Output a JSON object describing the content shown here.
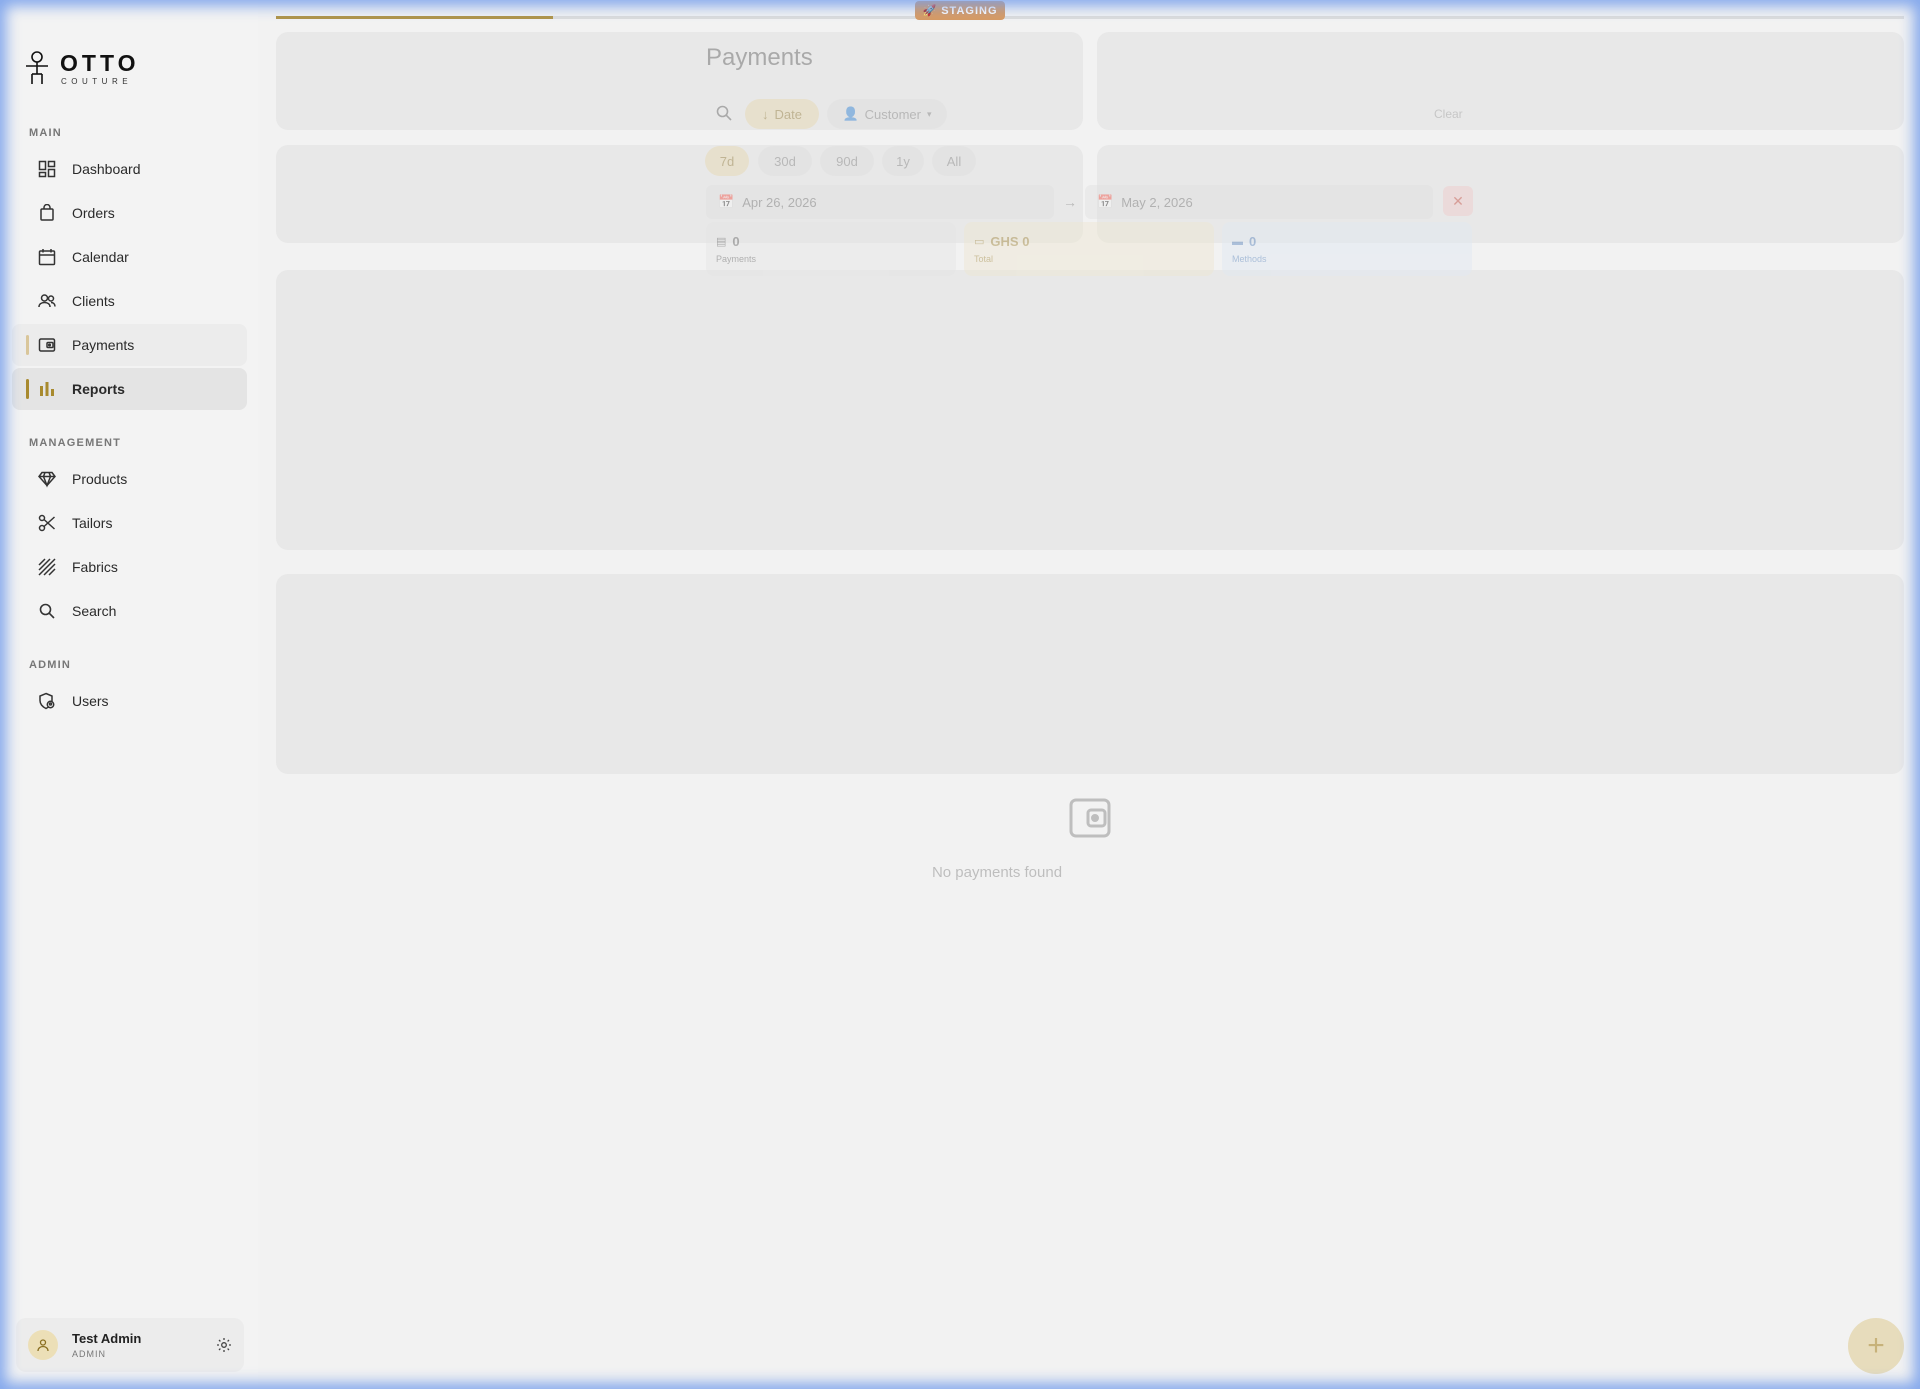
{
  "brand": {
    "name": "OTTO",
    "tagline": "COUTURE"
  },
  "banner": {
    "label": "STAGING"
  },
  "sidebar": {
    "sections": {
      "main": "MAIN",
      "management": "MANAGEMENT",
      "admin": "ADMIN"
    },
    "items": [
      {
        "label": "Dashboard",
        "icon": "dashboard-icon"
      },
      {
        "label": "Orders",
        "icon": "bag-icon"
      },
      {
        "label": "Calendar",
        "icon": "calendar-icon"
      },
      {
        "label": "Clients",
        "icon": "users-icon"
      },
      {
        "label": "Payments",
        "icon": "wallet-icon",
        "state": "hover"
      },
      {
        "label": "Reports",
        "icon": "bar-chart-icon",
        "state": "active"
      },
      {
        "label": "Products",
        "icon": "diamond-icon"
      },
      {
        "label": "Tailors",
        "icon": "scissors-icon"
      },
      {
        "label": "Fabrics",
        "icon": "fabric-icon"
      },
      {
        "label": "Search",
        "icon": "search-icon"
      },
      {
        "label": "Users",
        "icon": "user-shield-icon"
      }
    ],
    "user": {
      "name": "Test Admin",
      "role": "ADMIN"
    }
  },
  "loading": {
    "progress": 0.17
  },
  "payments": {
    "title": "Payments",
    "sort_chip": "Date",
    "customer_chip": "Customer",
    "clear": "Clear",
    "ranges": [
      "7d",
      "30d",
      "90d",
      "1y",
      "All"
    ],
    "selected_range": "7d",
    "date_from": "Apr 26, 2026",
    "date_to": "May 2, 2026",
    "stats": [
      {
        "value": "0",
        "label": "Payments"
      },
      {
        "value": "GHS 0",
        "label": "Total"
      },
      {
        "value": "0",
        "label": "Methods"
      }
    ],
    "empty": "No payments found"
  },
  "colors": {
    "accent": "#a88a2e",
    "staging": "#d79a63",
    "frame": "#7aa0eb"
  }
}
